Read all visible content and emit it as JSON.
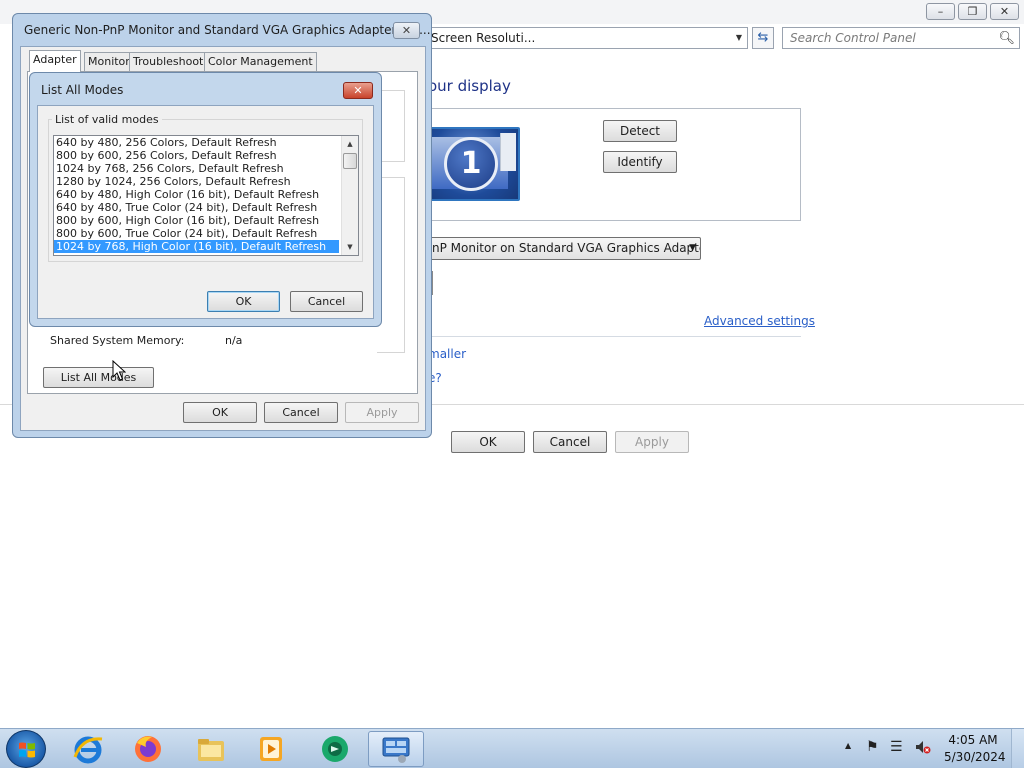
{
  "control_panel": {
    "address": "Screen Resoluti...",
    "search_placeholder": "Search Control Panel",
    "heading": "our display",
    "detect_label": "Detect",
    "identify_label": "Identify",
    "monitor_number": "1",
    "display_select_value": "nP Monitor on Standard VGA Graphics Adapter",
    "advanced_settings_label": "Advanced settings",
    "link_smaller": "maller",
    "link_question": "e?",
    "ok_label": "OK",
    "cancel_label": "Cancel",
    "apply_label": "Apply"
  },
  "properties_dialog": {
    "title": "Generic Non-PnP Monitor and Standard VGA Graphics Adapter Pro...",
    "tabs": [
      {
        "label": "Adapter",
        "active": true
      },
      {
        "label": "Monitor",
        "active": false
      },
      {
        "label": "Troubleshoot",
        "active": false
      },
      {
        "label": "Color Management",
        "active": false
      }
    ],
    "shared_memory_label": "Shared System Memory:",
    "shared_memory_value": "n/a",
    "list_all_modes_label": "List All Modes",
    "ok_label": "OK",
    "cancel_label": "Cancel",
    "apply_label": "Apply"
  },
  "modes_dialog": {
    "title": "List All Modes",
    "group_label": "List of valid modes",
    "modes": [
      "640 by 480, 256 Colors, Default Refresh",
      "800 by 600, 256 Colors, Default Refresh",
      "1024 by 768, 256 Colors, Default Refresh",
      "1280 by 1024, 256 Colors, Default Refresh",
      "640 by 480, High Color (16 bit), Default Refresh",
      "640 by 480, True Color (24 bit), Default Refresh",
      "800 by 600, High Color (16 bit), Default Refresh",
      "800 by 600, True Color (24 bit), Default Refresh",
      "1024 by 768, High Color (16 bit), Default Refresh"
    ],
    "selected_index": 8,
    "ok_label": "OK",
    "cancel_label": "Cancel"
  },
  "taskbar": {
    "apps": [
      {
        "name": "internet-explorer-icon",
        "active": false
      },
      {
        "name": "firefox-icon",
        "active": false
      },
      {
        "name": "file-explorer-icon",
        "active": false
      },
      {
        "name": "media-player-icon",
        "active": false
      },
      {
        "name": "green-app-icon",
        "active": false
      },
      {
        "name": "control-panel-icon",
        "active": true
      }
    ],
    "time": "4:05 AM",
    "date": "5/30/2024"
  },
  "colors": {
    "selection": "#3399ff",
    "link": "#2a5fc8",
    "heading": "#1e3287",
    "dialog_frame": "#bcd2ea"
  }
}
